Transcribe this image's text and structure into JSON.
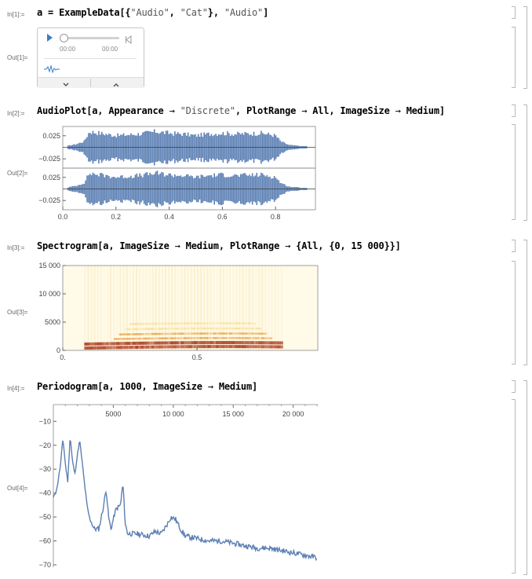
{
  "cells": [
    {
      "in_label": "In[1]:=",
      "out_label": "Out[1]=",
      "code": {
        "before": "a = ExampleData[{",
        "s1": "\"Audio\"",
        "mid1": ", ",
        "s2": "\"Cat\"",
        "mid2": "}, ",
        "s3": "\"Audio\"",
        "after": "]"
      },
      "player": {
        "elapsed": "00:00",
        "duration": "00:00",
        "play_icon": "play-triangle",
        "end_icon": "skip-end",
        "wave_icon": "waveform",
        "expand_icon": "chevron-down",
        "collapse_icon": "chevron-up",
        "progress": 0
      }
    },
    {
      "in_label": "In[2]:=",
      "out_label": "Out[2]=",
      "code": {
        "before": "AudioPlot[a, Appearance ",
        "arrow1": "→",
        "s1": " \"Discrete\"",
        "m1": ", PlotRange ",
        "arrow2": "→",
        "m2": " All, ImageSize ",
        "arrow3": "→",
        "after": " Medium]"
      }
    },
    {
      "in_label": "In[3]:=",
      "out_label": "Out[3]=",
      "code": {
        "before": "Spectrogram[a, ImageSize ",
        "arrow1": "→",
        "m1": " Medium, PlotRange ",
        "arrow2": "→",
        "after": " {All, {0, 15 000}}]"
      }
    },
    {
      "in_label": "In[4]:=",
      "out_label": "Out[4]=",
      "code": {
        "before": "Periodogram[a, 1000, ImageSize ",
        "arrow1": "→",
        "after": " Medium]"
      }
    }
  ],
  "chart_data": [
    {
      "type": "bar",
      "title": "",
      "channels": 2,
      "y_ticks": [
        "0.025",
        "−0.025"
      ],
      "x_ticks": [
        "0.0",
        "0.2",
        "0.4",
        "0.6",
        "0.8"
      ],
      "xlim": [
        0,
        0.95
      ],
      "ylim": [
        -0.045,
        0.045
      ],
      "envelope": {
        "x": [
          0.02,
          0.05,
          0.08,
          0.1,
          0.15,
          0.2,
          0.25,
          0.3,
          0.35,
          0.4,
          0.45,
          0.5,
          0.55,
          0.6,
          0.65,
          0.7,
          0.75,
          0.8,
          0.82,
          0.85,
          0.9
        ],
        "amplitude": [
          0.004,
          0.008,
          0.015,
          0.04,
          0.035,
          0.03,
          0.032,
          0.035,
          0.04,
          0.036,
          0.034,
          0.03,
          0.034,
          0.036,
          0.034,
          0.035,
          0.036,
          0.03,
          0.015,
          0.006,
          0.003
        ]
      },
      "color": "#5b7fb3"
    },
    {
      "type": "heatmap",
      "title": "",
      "y_ticks": [
        "15 000",
        "10 000",
        "5000",
        "0"
      ],
      "x_ticks": [
        "0.",
        "0.5"
      ],
      "xlim": [
        0,
        0.95
      ],
      "ylim": [
        0,
        15000
      ],
      "harmonics_hz": [
        500,
        1200,
        1900,
        2700,
        3600,
        4500
      ],
      "active_time": [
        0.08,
        0.82
      ],
      "colors": [
        "#fffbe8",
        "#f8d98a",
        "#e3902a",
        "#a8361a"
      ]
    },
    {
      "type": "line",
      "title": "",
      "x_ticks": [
        "5000",
        "10 000",
        "15 000",
        "20 000"
      ],
      "y_ticks": [
        "−10",
        "−20",
        "−30",
        "−40",
        "−50",
        "−60",
        "−70"
      ],
      "xlim": [
        0,
        22050
      ],
      "ylim": [
        -71,
        -3
      ],
      "x": [
        0,
        300,
        600,
        800,
        1000,
        1200,
        1400,
        1600,
        1800,
        2000,
        2200,
        2400,
        2600,
        2800,
        3000,
        3400,
        3800,
        4200,
        4400,
        4600,
        4800,
        5200,
        5600,
        5800,
        6000,
        6200,
        7000,
        8000,
        8500,
        9000,
        9500,
        9800,
        10200,
        10600,
        11000,
        12000,
        13000,
        14000,
        15000,
        16000,
        17000,
        18000,
        19000,
        20000,
        21000,
        22000
      ],
      "y": [
        -42,
        -38,
        -28,
        -17,
        -28,
        -35,
        -16,
        -27,
        -32,
        -24,
        -18,
        -27,
        -36,
        -45,
        -50,
        -55,
        -55,
        -45,
        -38,
        -50,
        -55,
        -47,
        -45,
        -36,
        -53,
        -57,
        -57,
        -58,
        -56,
        -57,
        -53,
        -50,
        -51,
        -55,
        -58,
        -59,
        -60,
        -60,
        -61,
        -62,
        -63,
        -63,
        -64,
        -65,
        -66,
        -67
      ],
      "color": "#5b7fb3"
    }
  ]
}
